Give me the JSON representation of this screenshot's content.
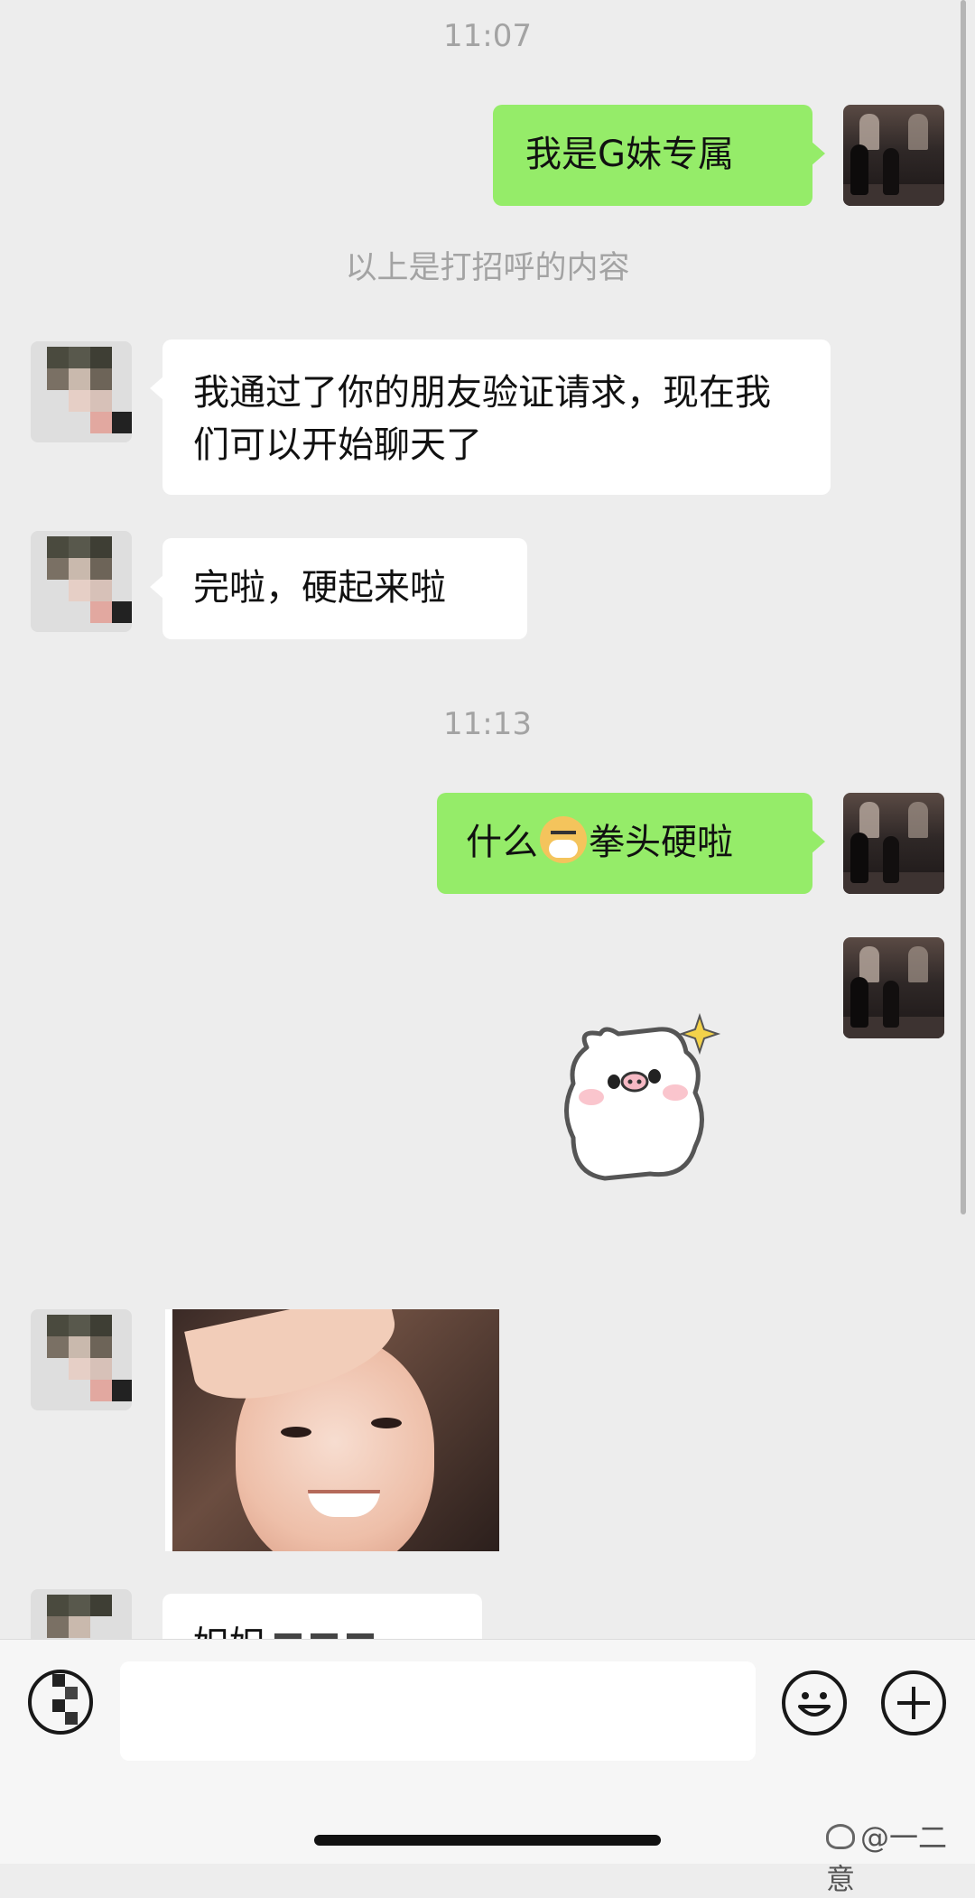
{
  "chat": {
    "time_1": "11:07",
    "msg_1": "我是G妹专属",
    "system_notice": "以上是打招呼的内容",
    "msg_2": "我通过了你的朋友验证请求，现在我们可以开始聊天了",
    "msg_3": "完啦，硬起来啦",
    "time_2": "11:13",
    "msg_4_before": "什么",
    "msg_4_emoji": "dog-face-emoji",
    "msg_4_after": "拳头硬啦",
    "msg_5_sticker": "pig-sticker",
    "msg_6_image": "selfie-photo",
    "msg_7_partial": "妲妲"
  },
  "input_bar": {
    "voice_icon": "voice-toggle-icon",
    "emoji_icon": "emoji-icon",
    "plus_icon": "plus-icon"
  },
  "watermark": "@一二意",
  "colors": {
    "background": "#ededed",
    "self_bubble": "#95ec69",
    "other_bubble": "#ffffff"
  }
}
